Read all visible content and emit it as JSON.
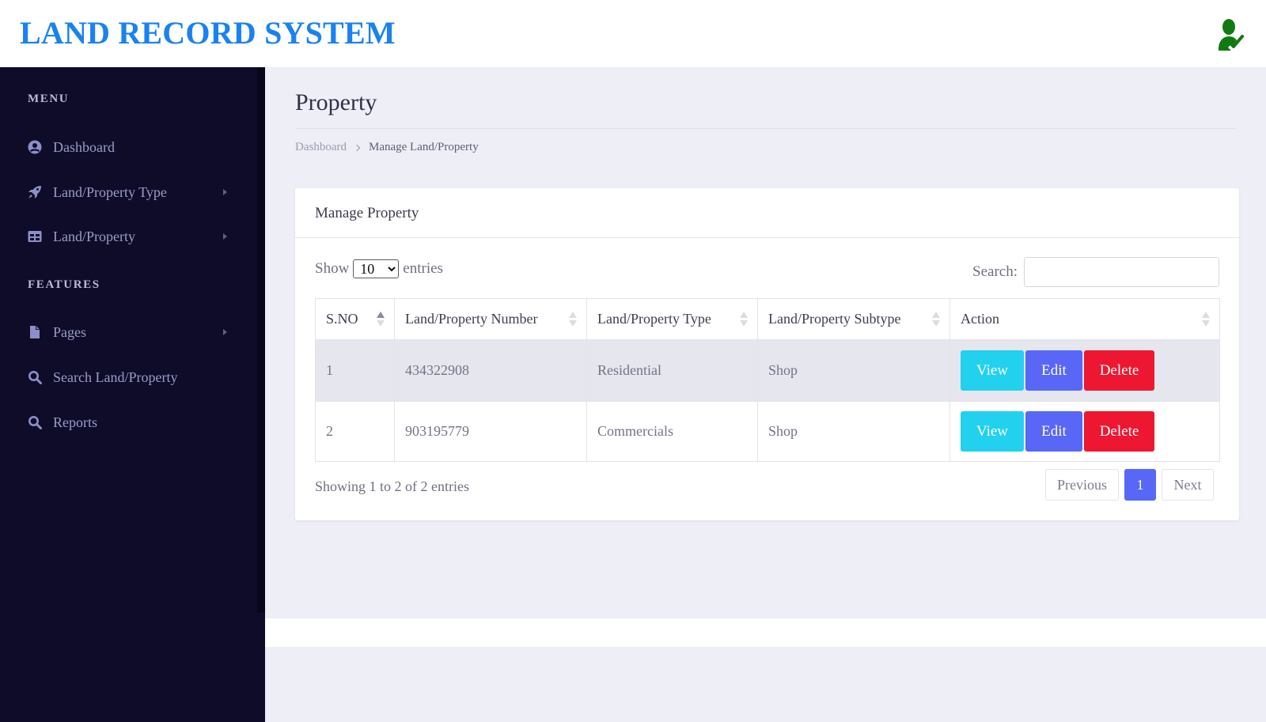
{
  "app": {
    "brand": "LAND RECORD SYSTEM",
    "user_icon": "user-check-icon",
    "brand_color": "#1a82f0",
    "user_icon_color": "#0f7a12"
  },
  "sidebar": {
    "sections": [
      {
        "title": "MENU",
        "items": [
          {
            "label": "Dashboard",
            "icon": "user-circle-icon",
            "has_submenu": false
          },
          {
            "label": "Land/Property Type",
            "icon": "rocket-icon",
            "has_submenu": true
          },
          {
            "label": "Land/Property",
            "icon": "table-icon",
            "has_submenu": true
          }
        ]
      },
      {
        "title": "FEATURES",
        "items": [
          {
            "label": "Pages",
            "icon": "file-icon",
            "has_submenu": true
          },
          {
            "label": "Search Land/Property",
            "icon": "search-icon",
            "has_submenu": false
          },
          {
            "label": "Reports",
            "icon": "search-icon",
            "has_submenu": false
          }
        ]
      }
    ]
  },
  "page": {
    "title": "Property",
    "breadcrumb": {
      "home": "Dashboard",
      "current": "Manage Land/Property"
    }
  },
  "card": {
    "title": "Manage Property",
    "length": {
      "show_label": "Show",
      "selected": "10",
      "entries_label": "entries"
    },
    "search": {
      "label": "Search:",
      "value": "",
      "placeholder": ""
    },
    "table": {
      "columns": [
        "S.NO",
        "Land/Property Number",
        "Land/Property Type",
        "Land/Property Subtype",
        "Action"
      ],
      "sorted_column": "S.NO",
      "sort_direction": "asc",
      "rows": [
        {
          "sno": "1",
          "number": "434322908",
          "type": "Residential",
          "subtype": "Shop"
        },
        {
          "sno": "2",
          "number": "903195779",
          "type": "Commercials",
          "subtype": "Shop"
        }
      ],
      "actions": {
        "view": "View",
        "edit": "Edit",
        "delete": "Delete"
      },
      "action_colors": {
        "view": "#22d1ee",
        "edit": "#5867f6",
        "delete": "#ed1731"
      }
    },
    "info": "Showing 1 to 2 of 2 entries",
    "pagination": {
      "previous": "Previous",
      "current_page": "1",
      "next": "Next"
    }
  }
}
